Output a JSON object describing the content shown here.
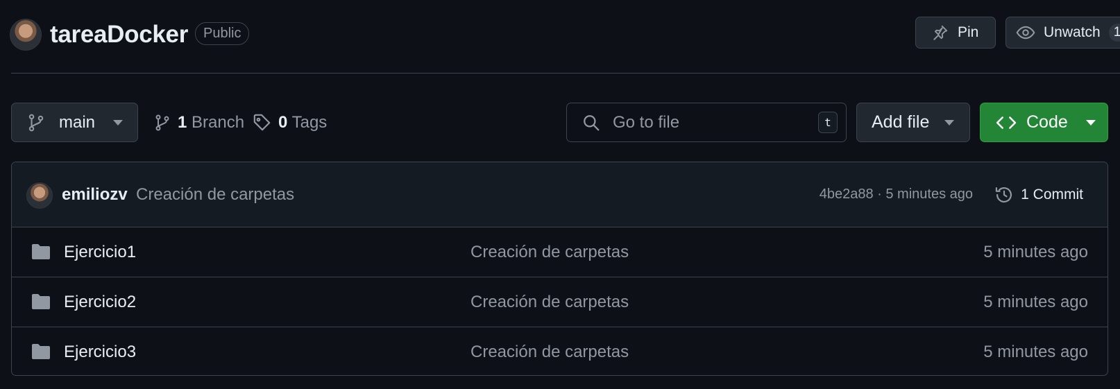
{
  "repo": {
    "name": "tareaDocker",
    "visibility": "Public",
    "pin_label": "Pin",
    "watch_label": "Unwatch",
    "watch_count": "1"
  },
  "toolbar": {
    "branch_name": "main",
    "branch_count": "1",
    "branch_label": "Branch",
    "tag_count": "0",
    "tag_label": "Tags",
    "search_placeholder": "Go to file",
    "search_shortcut": "t",
    "add_file_label": "Add file",
    "code_label": "Code"
  },
  "latest_commit": {
    "author": "emiliozv",
    "message": "Creación de carpetas",
    "meta": "4be2a88 · 5 minutes ago",
    "commit_count_label": "1 Commit"
  },
  "files": [
    {
      "name": "Ejercicio1",
      "message": "Creación de carpetas",
      "time": "5 minutes ago"
    },
    {
      "name": "Ejercicio2",
      "message": "Creación de carpetas",
      "time": "5 minutes ago"
    },
    {
      "name": "Ejercicio3",
      "message": "Creación de carpetas",
      "time": "5 minutes ago"
    }
  ],
  "colors": {
    "background": "#0d1117",
    "code_button": "#238636",
    "border": "#3d444d",
    "muted_text": "#9198a1"
  }
}
